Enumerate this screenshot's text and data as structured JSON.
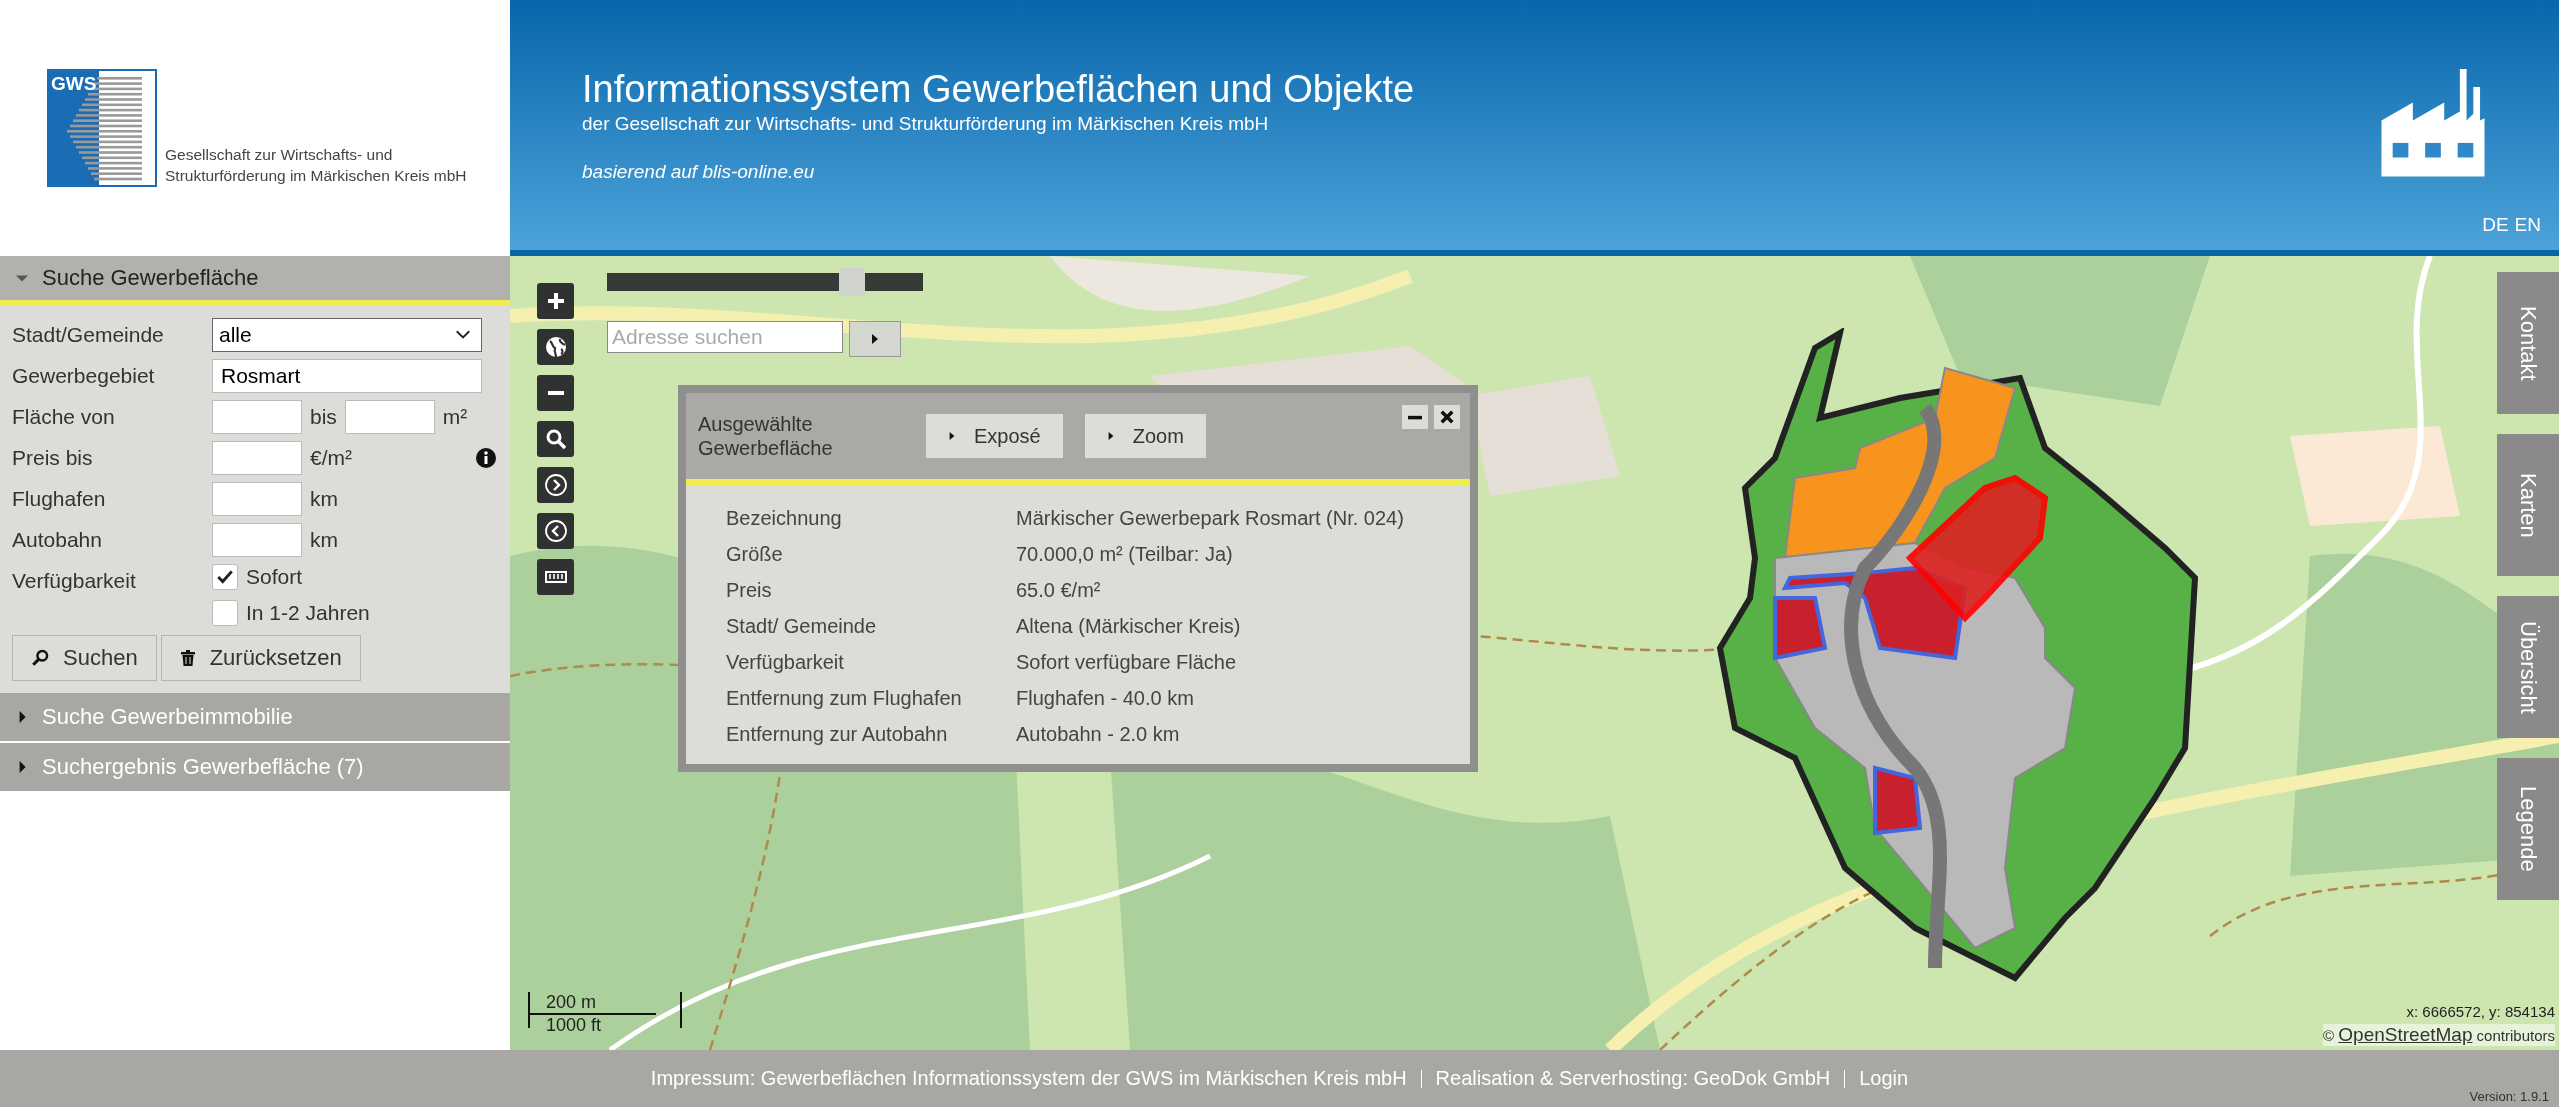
{
  "logo": {
    "abbr": "GWS",
    "lines": [
      "Gesellschaft zur Wirtschafts- und",
      "Strukturförderung im Märkischen Kreis mbH"
    ]
  },
  "header": {
    "title": "Informationssystem Gewerbeflächen und Objekte",
    "subtitle": "der Gesellschaft zur Wirtschafts- und Strukturförderung im Märkischen Kreis mbH",
    "tagline": "basierend auf blis-online.eu",
    "languages": [
      "DE",
      "EN"
    ]
  },
  "sidebar": {
    "sections": [
      {
        "title": "Suche Gewerbefläche",
        "expanded": true,
        "form": {
          "fields": [
            {
              "kind": "select",
              "label": "Stadt/Gemeinde",
              "value": "alle"
            },
            {
              "kind": "text",
              "label": "Gewerbegebiet",
              "value": "Rosmart"
            },
            {
              "kind": "range",
              "label": "Fläche von",
              "separator": "bis",
              "unit": "m²"
            },
            {
              "kind": "number",
              "label": "Preis bis",
              "unit": "€/m²",
              "info": true
            },
            {
              "kind": "number",
              "label": "Flughafen",
              "unit": "km"
            },
            {
              "kind": "number",
              "label": "Autobahn",
              "unit": "km"
            },
            {
              "kind": "checkboxes",
              "label": "Verfügbarkeit",
              "options": [
                {
                  "label": "Sofort",
                  "checked": true
                },
                {
                  "label": "In 1-2 Jahren",
                  "checked": false
                }
              ]
            }
          ],
          "buttons": [
            {
              "kind": "search",
              "label": "Suchen"
            },
            {
              "kind": "reset",
              "label": "Zurücksetzen"
            }
          ]
        }
      },
      {
        "title": "Suche Gewerbeimmobilie",
        "expanded": false
      },
      {
        "title": "Suchergebnis Gewerbefläche (7)",
        "expanded": false
      }
    ]
  },
  "map": {
    "opacity_slider": {
      "level": 0.8
    },
    "address_search": {
      "placeholder": "Adresse suchen"
    },
    "scale": [
      "200 m",
      "1000 ft"
    ],
    "coordinates": "x: 6666572, y: 854134",
    "attribution": {
      "prefix": "©",
      "link": "OpenStreetMap",
      "suffix": "contributors"
    },
    "side_tabs": [
      "Kontakt",
      "Karten",
      "Übersicht",
      "Legende"
    ],
    "popup": {
      "title": "Ausgewählte Gewerbefläche",
      "buttons": [
        "Exposé",
        "Zoom"
      ],
      "rows": [
        {
          "label": "Bezeichnung",
          "value": "Märkischer Gewerbepark Rosmart (Nr. 024)"
        },
        {
          "label": "Größe",
          "value": "70.000,0 m² (Teilbar: Ja)"
        },
        {
          "label": "Preis",
          "value": "65.0 €/m²"
        },
        {
          "label": "Stadt/ Gemeinde",
          "value": "Altena (Märkischer Kreis)"
        },
        {
          "label": "Verfügbarkeit",
          "value": "Sofort verfügbare Fläche"
        },
        {
          "label": "Entfernung zum Flughafen",
          "value": "Flughafen - 40.0 km"
        },
        {
          "label": "Entfernung zur Autobahn",
          "value": "Autobahn - 2.0 km"
        }
      ]
    }
  },
  "footer": {
    "links": [
      "Impressum: Gewerbeflächen Informationssystem der GWS im Märkischen Kreis mbH",
      "Realisation & Serverhosting: GeoDok GmbH",
      "Login"
    ],
    "version": "Version: 1.9.1"
  }
}
